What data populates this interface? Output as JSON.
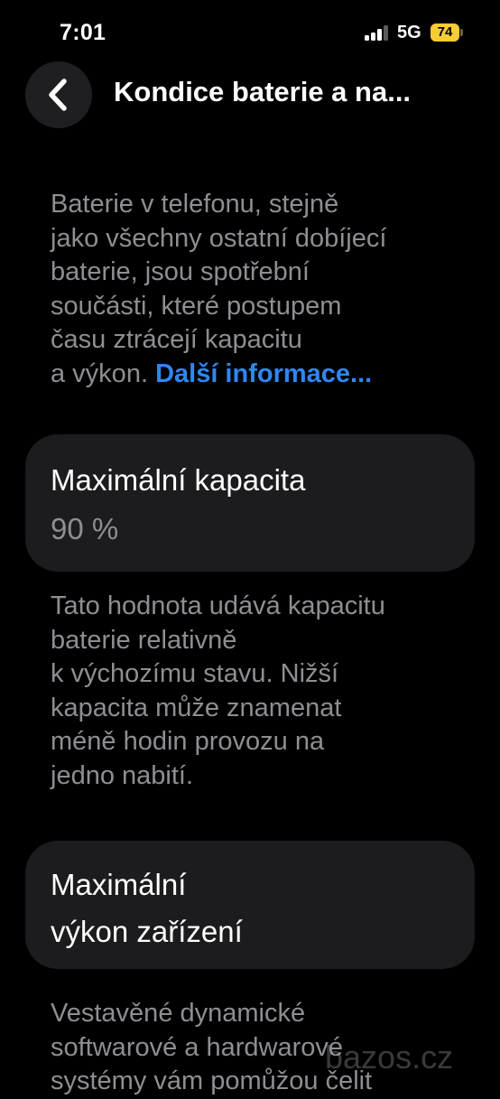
{
  "status_bar": {
    "time": "7:01",
    "network": "5G",
    "battery_level": "74",
    "signal_bars": 3,
    "signal_bars_total": 4
  },
  "header": {
    "back_icon": "chevron-left-icon",
    "title": "Kondice baterie a na..."
  },
  "intro": {
    "lines": [
      "Baterie v telefonu, stejně",
      "jako všechny ostatní dobíjecí",
      "baterie, jsou spotřební",
      "součásti, které postupem",
      "času ztrácejí kapacitu",
      "a výkon. "
    ],
    "link_label": "Další informace..."
  },
  "capacity_card": {
    "title": "Maximální kapacita",
    "value": "90 %"
  },
  "capacity_description": {
    "lines": [
      "Tato hodnota udává kapacitu",
      "baterie relativně",
      "k výchozímu stavu. Nižší",
      "kapacita může znamenat",
      "méně hodin provozu na",
      "jedno nabití."
    ]
  },
  "performance_card": {
    "title_lines": [
      "Maximální",
      "výkon zařízení"
    ]
  },
  "performance_description": {
    "lines": [
      "Vestavěné dynamické",
      "softwarové a hardwarové",
      "systémy vám pomůžou čelit"
    ]
  },
  "watermark": "bazos.cz",
  "colors": {
    "background": "#000000",
    "card": "#1c1c1e",
    "secondary_text": "#8e8e93",
    "link": "#2f87f0",
    "battery_fill": "#f7cc34"
  }
}
